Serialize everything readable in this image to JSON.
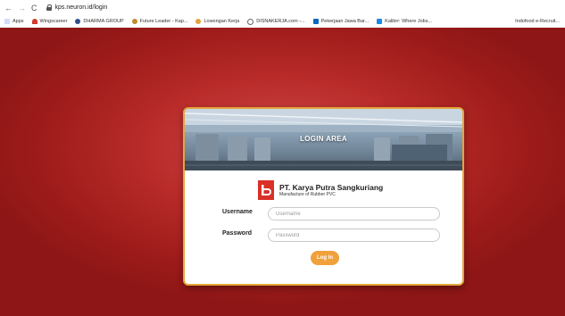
{
  "browser": {
    "url": "kps.neuron.id/login",
    "nav_icons": [
      "back-arrow-icon",
      "forward-arrow-icon",
      "reload-icon"
    ]
  },
  "bookmarks": [
    {
      "label": "Apps",
      "icon": "apps-grid-icon",
      "color": "#4a7de0"
    },
    {
      "label": "Wingscareer",
      "icon": "wings-icon",
      "color": "#d03a2e"
    },
    {
      "label": "DHARMA GROUP",
      "icon": "eye-icon",
      "color": "#2c4f8c"
    },
    {
      "label": "Future Leader - Kap...",
      "icon": "circle-logo-icon",
      "color": "#c08a2a"
    },
    {
      "label": "Lowongan Kerja",
      "icon": "spark-icon",
      "color": "#e2a23a"
    },
    {
      "label": "DISNAKERJA.com -...",
      "icon": "globe-icon",
      "color": "#666666"
    },
    {
      "label": "Pekerjaan Jawa Bar...",
      "icon": "linkedin-icon",
      "color": "#0a66c2"
    },
    {
      "label": "Kalibrr: Where Jobs...",
      "icon": "kalibrr-icon",
      "color": "#1e88e5"
    },
    {
      "label": "Indofood e-Recruit...",
      "icon": "",
      "color": ""
    }
  ],
  "login": {
    "banner_title": "LOGIN AREA",
    "company_name": "PT. Karya Putra Sangkuriang",
    "company_subtitle": "Manufacture of Rubber PVC",
    "username_label": "Username",
    "username_placeholder": "Username",
    "password_label": "Password",
    "password_placeholder": "Password",
    "login_button": "Log In"
  },
  "colors": {
    "background_red": "#b82b29",
    "card_border": "#e4a63a",
    "button": "#f0a13c",
    "logo": "#d9302a"
  }
}
